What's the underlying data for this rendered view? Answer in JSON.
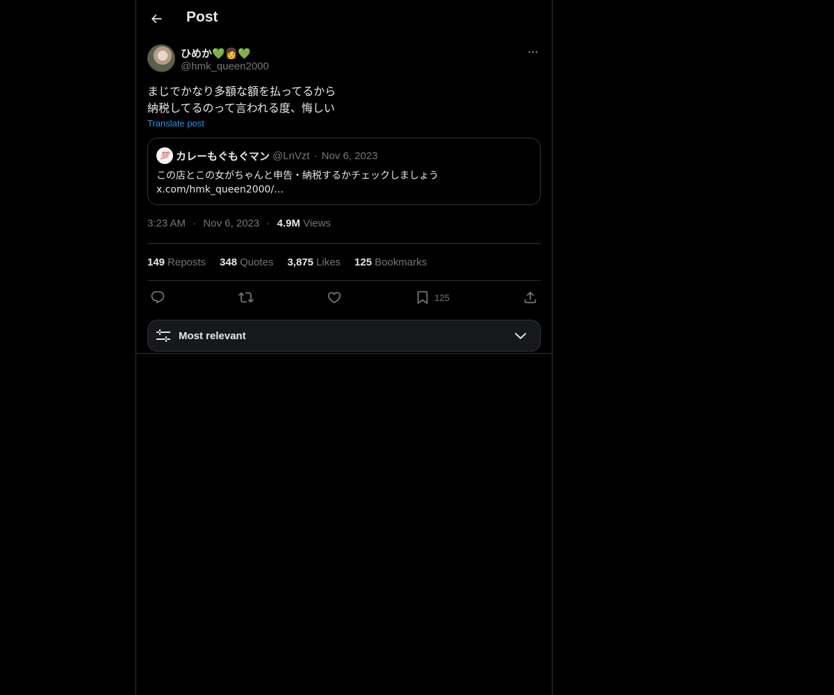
{
  "header": {
    "back_icon": "arrow-left-icon",
    "title": "Post"
  },
  "post": {
    "author": {
      "display_name": "ひめか💚👩💚",
      "handle": "@hmk_queen2000"
    },
    "more_icon": "ellipsis-icon",
    "text": "まじでかなり多額な額を払ってるから\n納税してるのって言われる度、悔しい",
    "translate_label": "Translate post",
    "quote": {
      "avatar_emoji": "💯",
      "name": "カレーもぐもぐマン",
      "handle": "@LnVzt",
      "separator": "·",
      "date": "Nov 6, 2023",
      "text": "この店とこの女がちゃんと申告・納税するかチェックしましょう\nx.com/hmk_queen2000/…"
    },
    "meta": {
      "time": "3:23 AM",
      "separator": "·",
      "date": "Nov 6, 2023",
      "views_count": "4.9M",
      "views_label": "Views"
    },
    "stats": [
      {
        "count": "149",
        "label": "Reposts"
      },
      {
        "count": "348",
        "label": "Quotes"
      },
      {
        "count": "3,875",
        "label": "Likes"
      },
      {
        "count": "125",
        "label": "Bookmarks"
      }
    ],
    "actions": {
      "reply_icon": "reply-icon",
      "repost_icon": "repost-icon",
      "like_icon": "heart-icon",
      "bookmark_icon": "bookmark-icon",
      "bookmark_count": "125",
      "share_icon": "share-icon"
    }
  },
  "sort": {
    "icon": "sliders-icon",
    "label": "Most relevant",
    "chevron_icon": "chevron-down-icon"
  },
  "colors": {
    "background": "#000000",
    "text": "#e7e9ea",
    "muted": "#71767b",
    "border": "#2f3336",
    "link": "#1d9bf0"
  }
}
